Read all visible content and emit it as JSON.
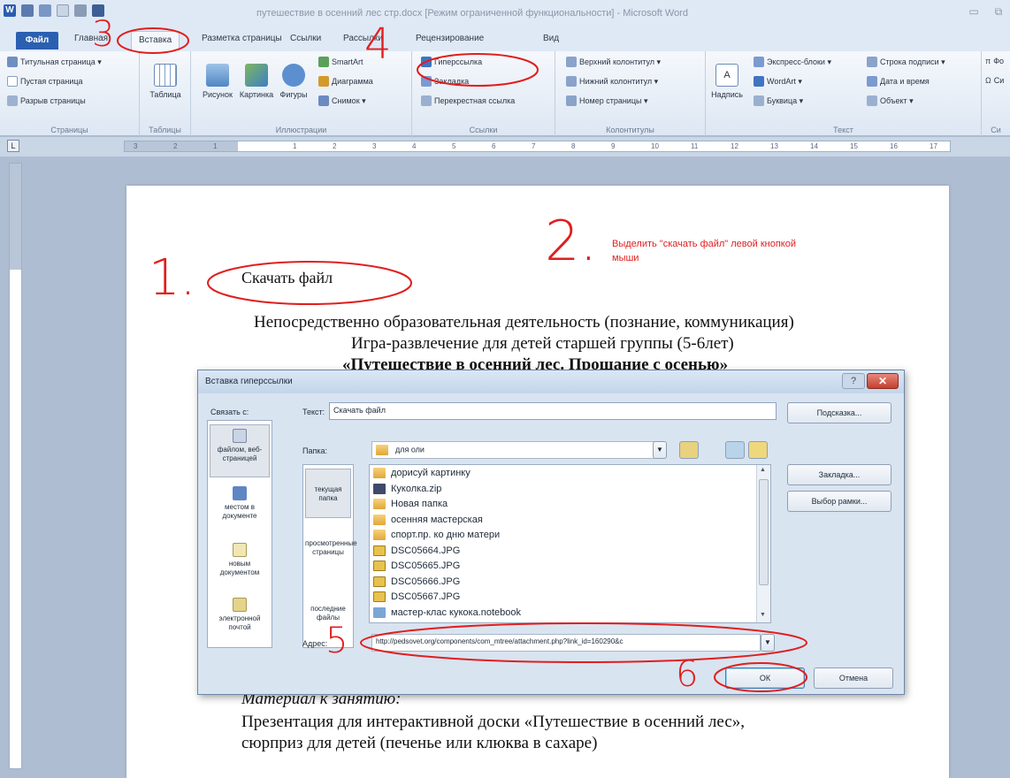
{
  "window": {
    "title": "путешествие в осенний лес стр.docx [Режим ограниченной функциональности] - Microsoft Word",
    "minimize": "▭",
    "restore": "⧉"
  },
  "tabs": [
    "Файл",
    "Главная",
    "Вставка",
    "Разметка страницы",
    "Ссылки",
    "Рассылки",
    "Рецензирование",
    "Вид"
  ],
  "ribbon": {
    "pages_group": {
      "items": [
        "Титульная страница ▾",
        "Пустая страница",
        "Разрыв страницы"
      ],
      "label": "Страницы"
    },
    "tables_group": {
      "button": "Таблица",
      "label": "Таблицы"
    },
    "illustrations_group": {
      "buttons": [
        "Рисунок",
        "Картинка",
        "Фигуры"
      ],
      "small": [
        "SmartArt",
        "Диаграмма",
        "Снимок ▾"
      ],
      "label": "Иллюстрации"
    },
    "links_group": {
      "items": [
        "Гиперссылка",
        "Закладка",
        "Перекрестная ссылка"
      ],
      "label": "Ссылки"
    },
    "headerfooter_group": {
      "items": [
        "Верхний колонтитул ▾",
        "Нижний колонтитул ▾",
        "Номер страницы ▾"
      ],
      "label": "Колонтитулы"
    },
    "text_group": {
      "button": "Надпись",
      "col1": [
        "Экспресс-блоки ▾",
        "WordArt ▾",
        "Буквица ▾"
      ],
      "col2": [
        "Строка подписи ▾",
        "Дата и время",
        "Объект ▾"
      ],
      "label": "Текст"
    },
    "symbols_group": {
      "items": [
        "Фо",
        "Си"
      ],
      "label": "Си"
    }
  },
  "ruler": {
    "tab_marker": "L",
    "numbers": [
      "3",
      "2",
      "1",
      "",
      "1",
      "2",
      "3",
      "4",
      "5",
      "6",
      "7",
      "8",
      "9",
      "10",
      "11",
      "12",
      "13",
      "14",
      "15",
      "16",
      "17"
    ]
  },
  "document": {
    "link_text": "Скачать файл",
    "line1": "Непосредственно образовательная деятельность (познание, коммуникация)",
    "line2": "Игра-развлечение для детей старшей группы (5-6лет)",
    "line3": "«Путешествие в осенний лес. Прощание с осенью»",
    "materials_heading": "Материал к занятию:",
    "materials_1": "Презентация для интерактивной доски «Путешествие в осенний лес»,",
    "materials_2": "сюрприз для детей (печенье или клюква в сахаре)"
  },
  "annotations": {
    "n1": "1.",
    "n2": "2.",
    "n3": "3",
    "n4": "4",
    "n5": "5",
    "n6": "6",
    "note": "Выделить \"скачать файл\" левой кнопкой мыши"
  },
  "dialog": {
    "title": "Вставка гиперссылки",
    "help": "?",
    "close": "✕",
    "link_to_label": "Связать с:",
    "text_label": "Текст:",
    "text_value": "Скачать файл",
    "hint_button": "Подсказка...",
    "folder_label": "Папка:",
    "folder_value": "для оли",
    "link_options": [
      {
        "label": "файлом, веб-страницей"
      },
      {
        "label": "местом в документе"
      },
      {
        "label": "новым документом"
      },
      {
        "label": "электронной почтой"
      }
    ],
    "nav_options": [
      "текущая папка",
      "просмотренные страницы",
      "последние файлы"
    ],
    "files": [
      {
        "name": "дорисуй картинку",
        "type": "folder"
      },
      {
        "name": "Куколка.zip",
        "type": "zip"
      },
      {
        "name": "Новая папка",
        "type": "folder"
      },
      {
        "name": "осенняя мастерская",
        "type": "folder"
      },
      {
        "name": "спорт.пр. ко дню матери",
        "type": "folder"
      },
      {
        "name": "DSC05664.JPG",
        "type": "jpg"
      },
      {
        "name": "DSC05665.JPG",
        "type": "jpg"
      },
      {
        "name": "DSC05666.JPG",
        "type": "jpg"
      },
      {
        "name": "DSC05667.JPG",
        "type": "jpg"
      },
      {
        "name": "мастер-клас кукока.notebook",
        "type": "notebook"
      }
    ],
    "bookmark_button": "Закладка...",
    "target_frame_button": "Выбор рамки...",
    "address_label": "Адрес:",
    "address_value": "http://pedsovet.org/components/com_mtree/attachment.php?link_id=160290&c",
    "ok_button": "ОК",
    "cancel_button": "Отмена"
  },
  "colors": {
    "annotation_red": "#e01e1e",
    "file_tab_blue": "#2b5fb1"
  }
}
